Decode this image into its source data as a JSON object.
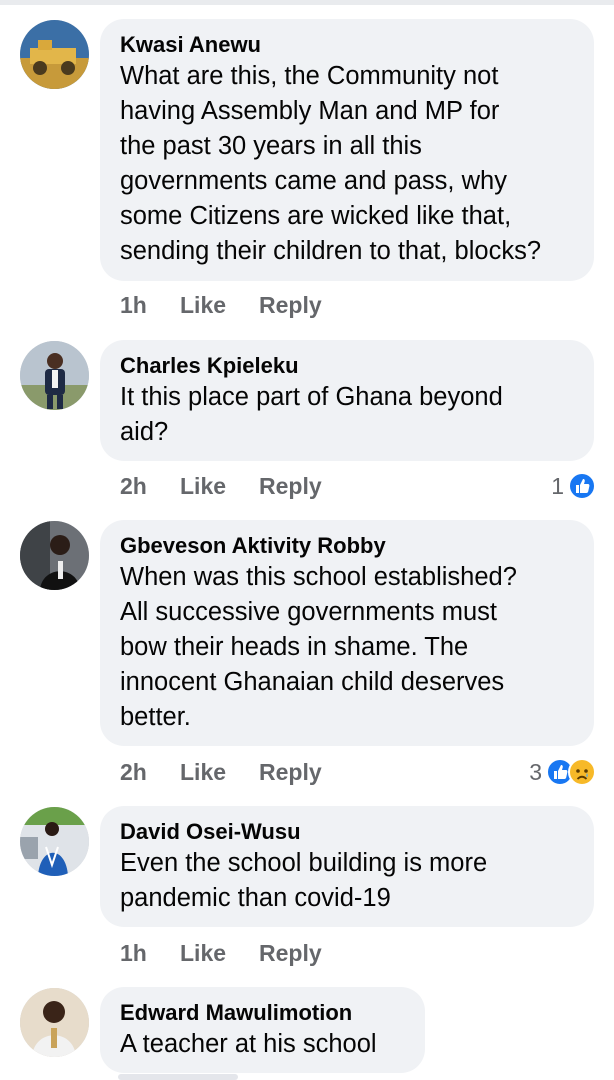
{
  "comments": [
    {
      "author": "Kwasi Anewu",
      "lines": [
        "What are this, the Community not",
        "having Assembly Man and MP for",
        "the past 30 years in all this",
        "governments came and pass, why",
        "some Citizens are wicked like that,",
        "sending their children to that, blocks?"
      ],
      "time": "1h",
      "like": "Like",
      "reply": "Reply",
      "reaction_count": ""
    },
    {
      "author": "Charles Kpieleku",
      "lines": [
        "It this place part of Ghana beyond",
        "aid?"
      ],
      "time": "2h",
      "like": "Like",
      "reply": "Reply",
      "reaction_count": "1"
    },
    {
      "author": "Gbeveson Aktivity Robby",
      "lines": [
        "When was this school established?",
        "All successive governments must",
        "bow their heads in shame. The",
        "innocent Ghanaian child deserves",
        "better."
      ],
      "time": "2h",
      "like": "Like",
      "reply": "Reply",
      "reaction_count": "3"
    },
    {
      "author": "David Osei-Wusu",
      "lines": [
        "Even the school building is more",
        "pandemic than covid-19"
      ],
      "time": "1h",
      "like": "Like",
      "reply": "Reply",
      "reaction_count": ""
    },
    {
      "author": "Edward Mawulimotion",
      "lines": [
        "A teacher at his school"
      ],
      "time": "",
      "like": "",
      "reply": "",
      "reaction_count": ""
    }
  ],
  "colors": {
    "bubble": "#f0f2f5",
    "meta_text": "#65676b",
    "like_blue": "#1877f2",
    "sad_yellow": "#f7b928"
  },
  "icons": {
    "like_reaction": "thumbs-up-icon",
    "sad_reaction": "sad-face-icon"
  }
}
